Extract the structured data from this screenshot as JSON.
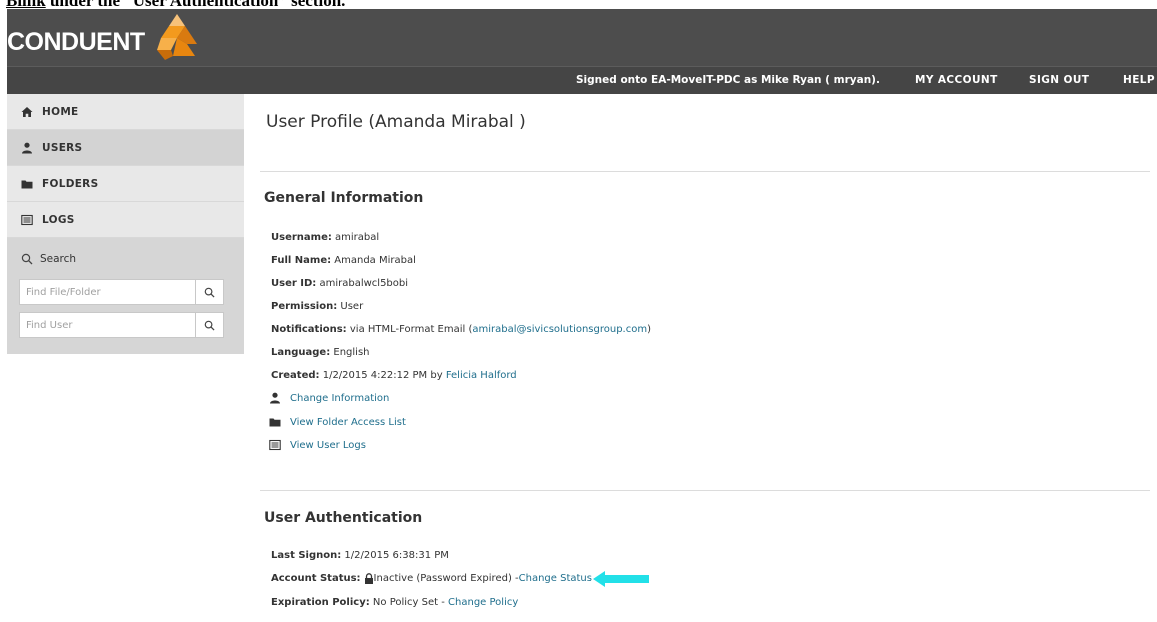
{
  "doc_caption": {
    "step": "Blink",
    "text": " under the “User Authentication” section."
  },
  "header": {
    "logo_text": "CONDUENT",
    "signed_prefix": "Signed onto ",
    "server": "EA-MoveIT-PDC",
    "signed_mid": " as ",
    "user": "Mike Ryan",
    "signed_suffix": " ( mryan).",
    "my_account": "MY ACCOUNT",
    "sign_out": "SIGN OUT",
    "help": "HELP"
  },
  "sidebar": {
    "items": [
      {
        "label": "HOME",
        "icon": "home-icon"
      },
      {
        "label": "USERS",
        "icon": "user-icon"
      },
      {
        "label": "FOLDERS",
        "icon": "folder-icon"
      },
      {
        "label": "LOGS",
        "icon": "logs-icon"
      }
    ],
    "search_title": "Search",
    "find_file_placeholder": "Find File/Folder",
    "find_user_placeholder": "Find User"
  },
  "main": {
    "page_title": "User Profile (Amanda Mirabal )",
    "general": {
      "title": "General Information",
      "username_label": "Username:",
      "username": " amirabal",
      "fullname_label": "Full Name:",
      "fullname": " Amanda Mirabal",
      "userid_label": "User ID:",
      "userid": " amirabalwcl5bobi",
      "permission_label": "Permission:",
      "permission": " User",
      "notifications_label": "Notifications:",
      "notifications": "  via HTML-Format Email (",
      "notifications_email": "amirabal@sivicsolutionsgroup.com",
      "notifications_end": ")",
      "language_label": "Language:",
      "language": "  English",
      "created_label": "Created:",
      "created": "  1/2/2015 4:22:12 PM by ",
      "created_by": "Felicia Halford",
      "change_information": "Change Information",
      "view_folder_access": "View Folder Access List",
      "view_user_logs": "View User Logs"
    },
    "auth": {
      "title": "User Authentication",
      "last_signon_label": "Last Signon:",
      "last_signon": " 1/2/2015 6:38:31 PM",
      "status_label": "Account Status:",
      "status": " Inactive (Password Expired) - ",
      "change_status": "Change Status",
      "expiration_label": "Expiration Policy:",
      "expiration": " No Policy Set  -  ",
      "change_policy": "Change Policy"
    }
  },
  "colors": {
    "header_bg": "#4d4d4d",
    "link": "#1f6e8c",
    "arrow": "#22e0e8",
    "logo_orange": "#f39a1e"
  }
}
